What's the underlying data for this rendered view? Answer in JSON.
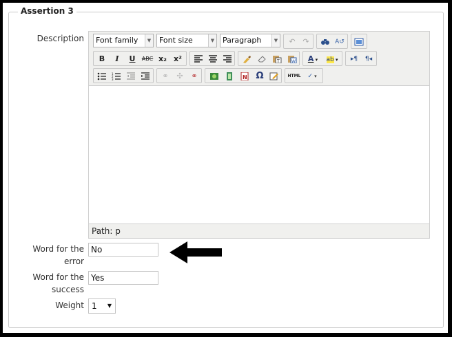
{
  "fieldset": {
    "legend": "Assertion 3"
  },
  "labels": {
    "description": "Description",
    "error_word_line1": "Word for the",
    "error_word_line2": "error",
    "success_word_line1": "Word for the",
    "success_word_line2": "success",
    "weight": "Weight"
  },
  "editor": {
    "font_family": "Font family",
    "font_size": "Font size",
    "format": "Paragraph",
    "path": "Path: p",
    "toolbar1_icons": [
      "undo-icon",
      "redo-icon",
      "find-icon",
      "replace-icon",
      "fullscreen-icon"
    ],
    "toolbar2_icons": [
      "bold-icon",
      "italic-icon",
      "underline-icon",
      "strikethrough-icon",
      "subscript-icon",
      "superscript-icon",
      "align-left-icon",
      "align-center-icon",
      "align-right-icon",
      "cleanup-icon",
      "eraser-icon",
      "paste-text-icon",
      "paste-word-icon",
      "text-color-icon",
      "highlight-color-icon",
      "ltr-icon",
      "rtl-icon"
    ],
    "toolbar3_icons": [
      "bullet-list-icon",
      "numbered-list-icon",
      "outdent-icon",
      "indent-icon",
      "link-icon",
      "unlink-icon",
      "anchor-icon",
      "image-icon",
      "media-icon",
      "nolink-icon",
      "special-char-icon",
      "edit-icon",
      "html-icon",
      "spellcheck-icon"
    ],
    "glyphs": {
      "bold": "B",
      "italic": "I",
      "underline": "U",
      "strike": "ABC",
      "sub": "x₂",
      "sup": "x²",
      "omega": "Ω",
      "html": "HTML"
    }
  },
  "fields": {
    "error_word_value": "No",
    "success_word_value": "Yes",
    "weight_value": "1"
  },
  "colors": {
    "background": "#000000",
    "panel": "#ffffff",
    "arrow": "#000000"
  }
}
